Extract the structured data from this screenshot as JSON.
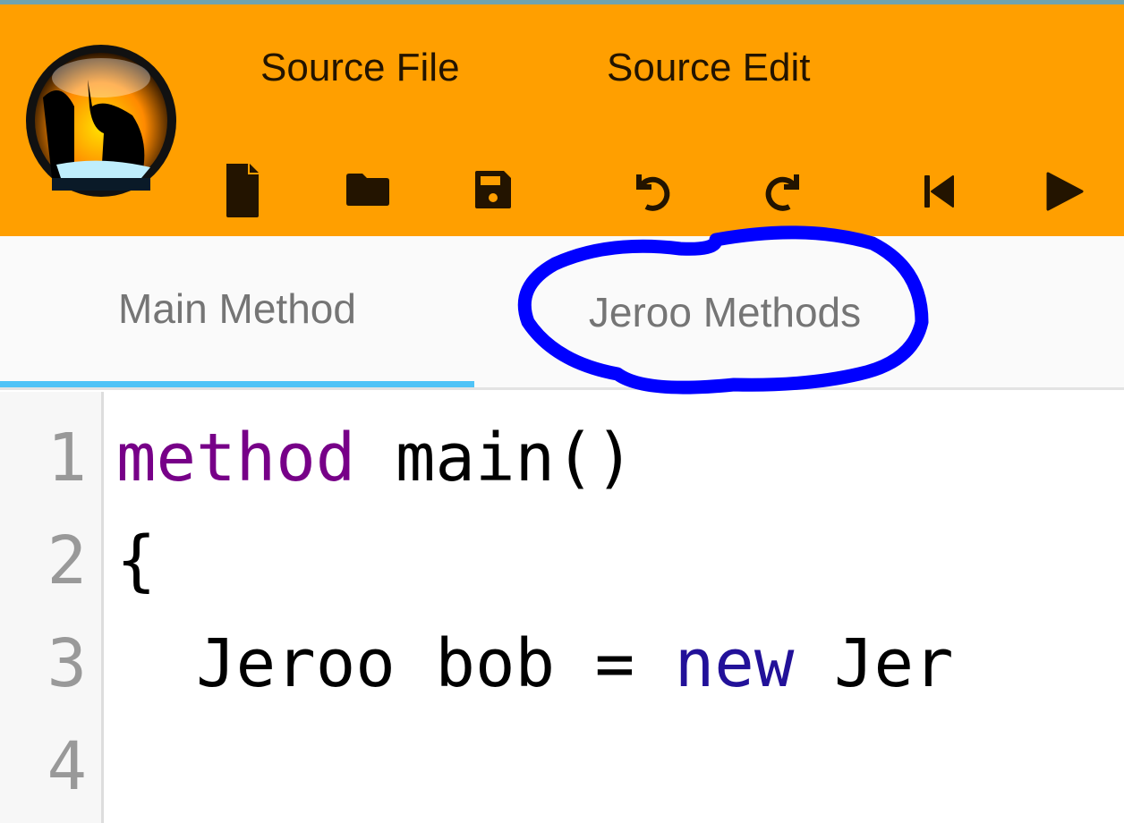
{
  "header": {
    "logo": "jeroo-kangaroo-logo",
    "menus": [
      {
        "label": "Source File"
      },
      {
        "label": "Source Edit"
      }
    ],
    "toolbar": [
      {
        "icon": "new-file-icon"
      },
      {
        "icon": "open-folder-icon"
      },
      {
        "icon": "save-icon"
      },
      {
        "icon": "undo-icon"
      },
      {
        "icon": "redo-icon"
      },
      {
        "icon": "reset-icon"
      },
      {
        "icon": "run-icon"
      }
    ],
    "color": "#ff9f00"
  },
  "tabs": [
    {
      "label": "Main Method",
      "active": true
    },
    {
      "label": "Jeroo Methods",
      "active": false,
      "annotated": true
    }
  ],
  "editor": {
    "line_numbers": [
      "1",
      "2",
      "3",
      "4"
    ],
    "lines": [
      {
        "kw": "method",
        "rest": " main()"
      },
      {
        "text": "{"
      },
      {
        "pre": "  Jeroo bob = ",
        "kw": "new",
        "post": " Jer"
      },
      {
        "text": ""
      }
    ]
  },
  "colors": {
    "accent": "#4fc3f7",
    "annotation": "#0000ff",
    "keyword": "#770088",
    "keyword_new": "#221199"
  }
}
